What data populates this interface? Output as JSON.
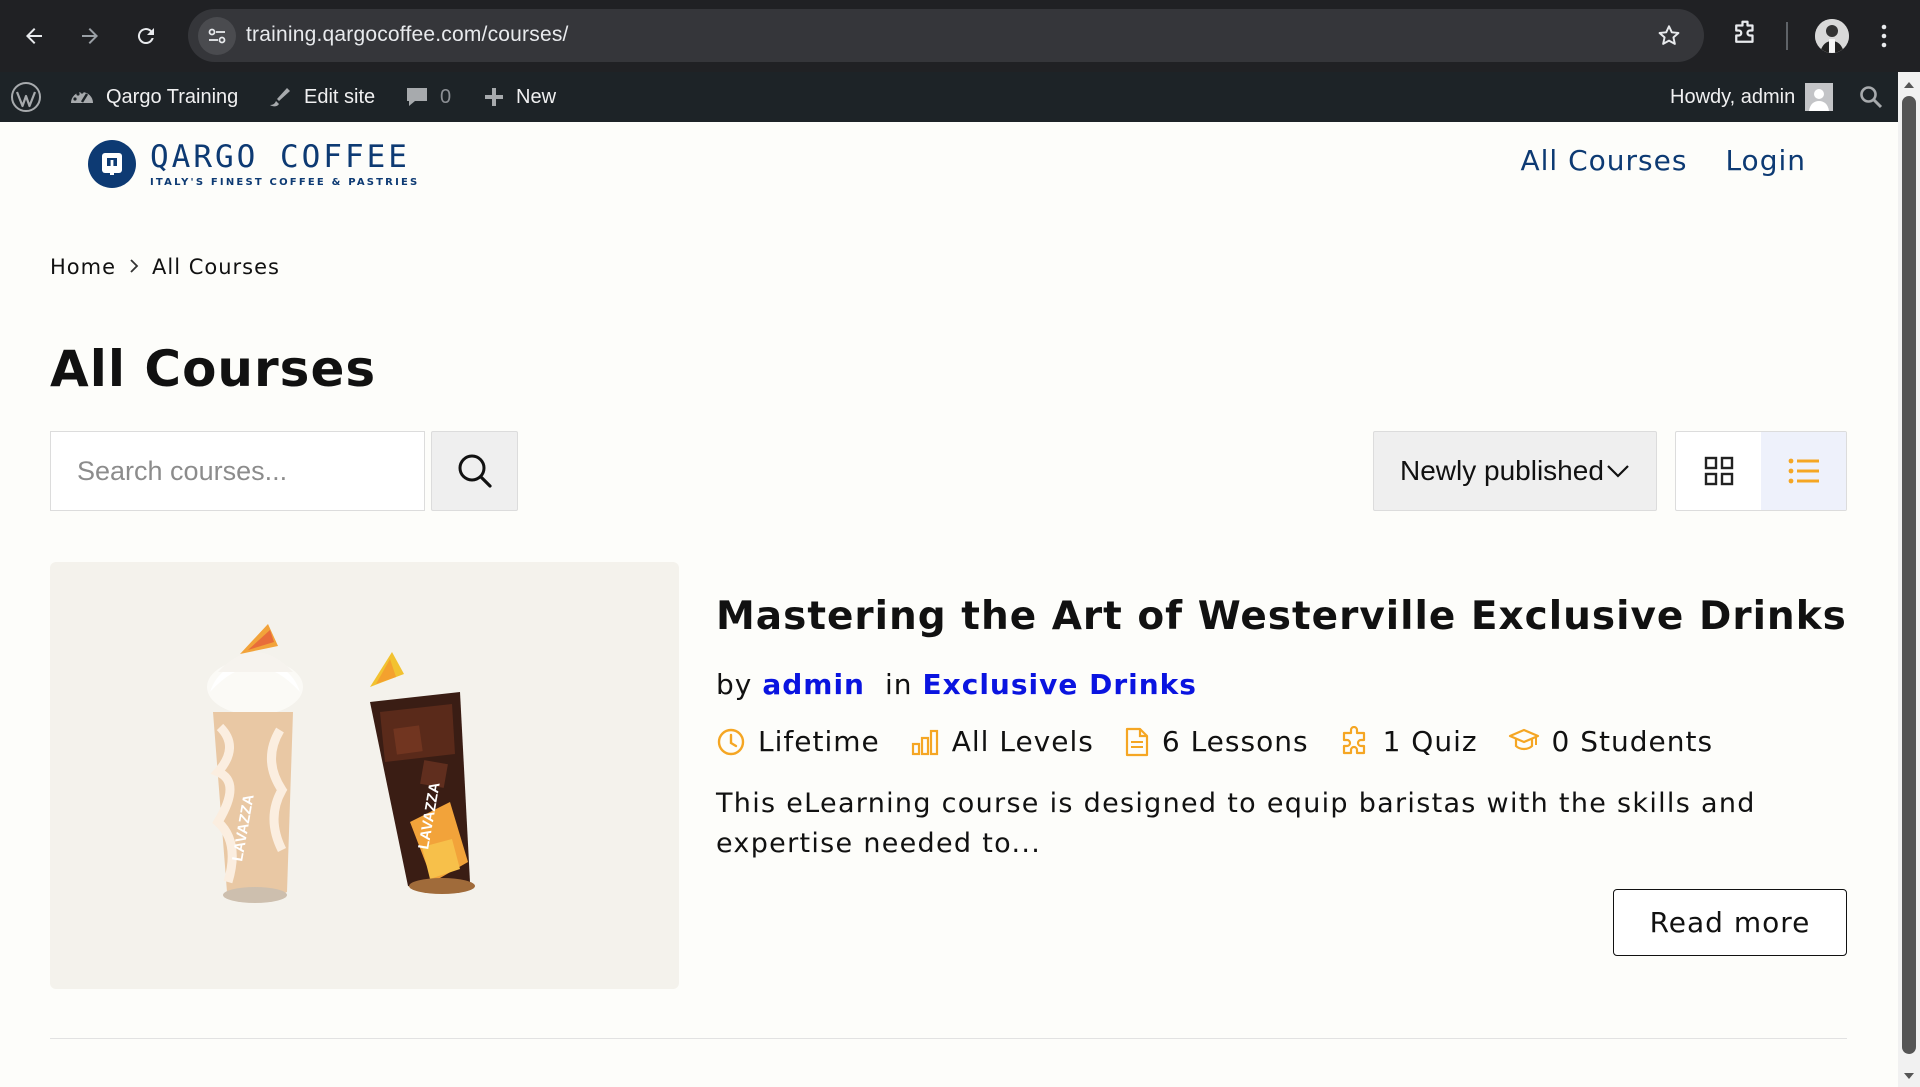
{
  "browser": {
    "url": "training.qargocoffee.com/courses/"
  },
  "adminbar": {
    "site_name": "Qargo Training",
    "edit_site": "Edit site",
    "comments_count": "0",
    "new_label": "New",
    "howdy": "Howdy, admin"
  },
  "site": {
    "logo_name": "QARGO COFFEE",
    "logo_tagline": "ITALY'S FINEST COFFEE & PASTRIES",
    "nav": [
      "All Courses",
      "Login"
    ]
  },
  "breadcrumb": [
    "Home",
    "All Courses"
  ],
  "page_title": "All Courses",
  "search": {
    "placeholder": "Search courses...",
    "value": ""
  },
  "sort": {
    "selected": "Newly published"
  },
  "view_mode": "list",
  "colors": {
    "accent": "#f5a623",
    "brand": "#0d3a73",
    "link": "#0a14e0"
  },
  "course": {
    "title": "Mastering the Art of Westerville Exclusive Drinks",
    "by_label": "by",
    "author": "admin",
    "in_label": "in",
    "category": "Exclusive Drinks",
    "meta": {
      "duration": "Lifetime",
      "level": "All Levels",
      "lessons": "6 Lessons",
      "quiz": "1 Quiz",
      "students": "0 Students"
    },
    "excerpt": "This eLearning course is designed to equip baristas with the skills and expertise needed to...",
    "read_more": "Read more",
    "cup_brand": "LAVAZZA"
  }
}
